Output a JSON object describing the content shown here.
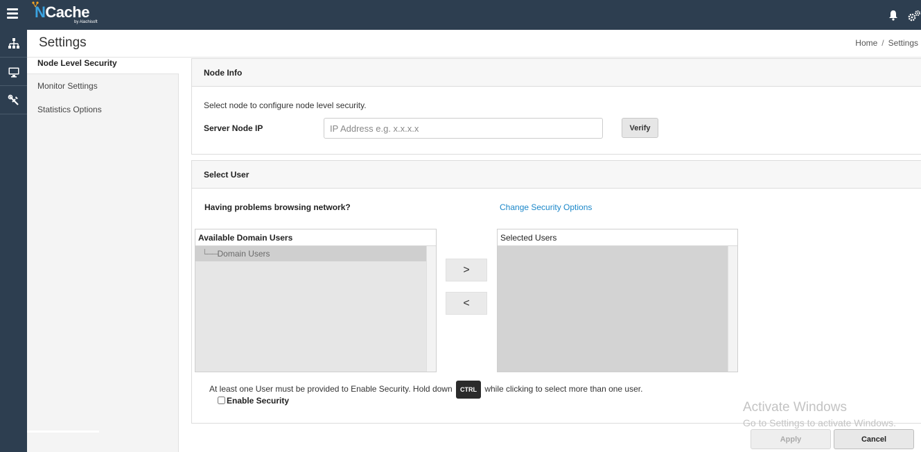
{
  "app": {
    "logo_text_prefix": "N",
    "logo_text_rest": "Cache",
    "logo_sub": "by Alachisoft"
  },
  "topbar": {
    "icons": [
      "hamburger-menu-icon",
      "bell-icon",
      "gears-icon"
    ]
  },
  "rail": {
    "items": [
      {
        "icon": "topology-icon"
      },
      {
        "icon": "monitor-icon"
      },
      {
        "icon": "tools-icon"
      }
    ]
  },
  "header": {
    "title": "Settings",
    "breadcrumb": [
      "Home",
      "Settings"
    ],
    "breadcrumb_sep": "/"
  },
  "sidenav": {
    "items": [
      {
        "label": "Node Level Security",
        "active": true
      },
      {
        "label": "Monitor Settings",
        "active": false
      },
      {
        "label": "Statistics Options",
        "active": false
      }
    ]
  },
  "node_info": {
    "title": "Node Info",
    "instruction": "Select node to configure node level security.",
    "server_label": "Server Node IP",
    "ip_placeholder": "IP Address e.g. x.x.x.x",
    "ip_value": "",
    "verify_label": "Verify"
  },
  "select_user": {
    "title": "Select User",
    "problem_text": "Having problems browsing network?",
    "change_link": "Change Security Options",
    "available": {
      "title": "Available Domain Users",
      "tree_prefix": "└──",
      "items": [
        "Domain Users"
      ]
    },
    "selected": {
      "title": "Selected Users",
      "items": []
    },
    "add_glyph": ">",
    "remove_glyph": "<",
    "hint_before": "At least one User must be provided to Enable Security. Hold down",
    "ctrl_key": "CTRL",
    "hint_after": "while clicking to select more than one user.",
    "enable_label": "Enable Security",
    "enable_checked": false
  },
  "watermark": {
    "line1": "Activate Windows",
    "line2": "Go to Settings to activate Windows."
  },
  "footer": {
    "apply_label": "Apply",
    "cancel_label": "Cancel",
    "apply_enabled": false
  },
  "colors": {
    "topbar_bg": "#2d3e50",
    "link": "#1b87c9",
    "logo_accent": "#3ba3e0"
  }
}
